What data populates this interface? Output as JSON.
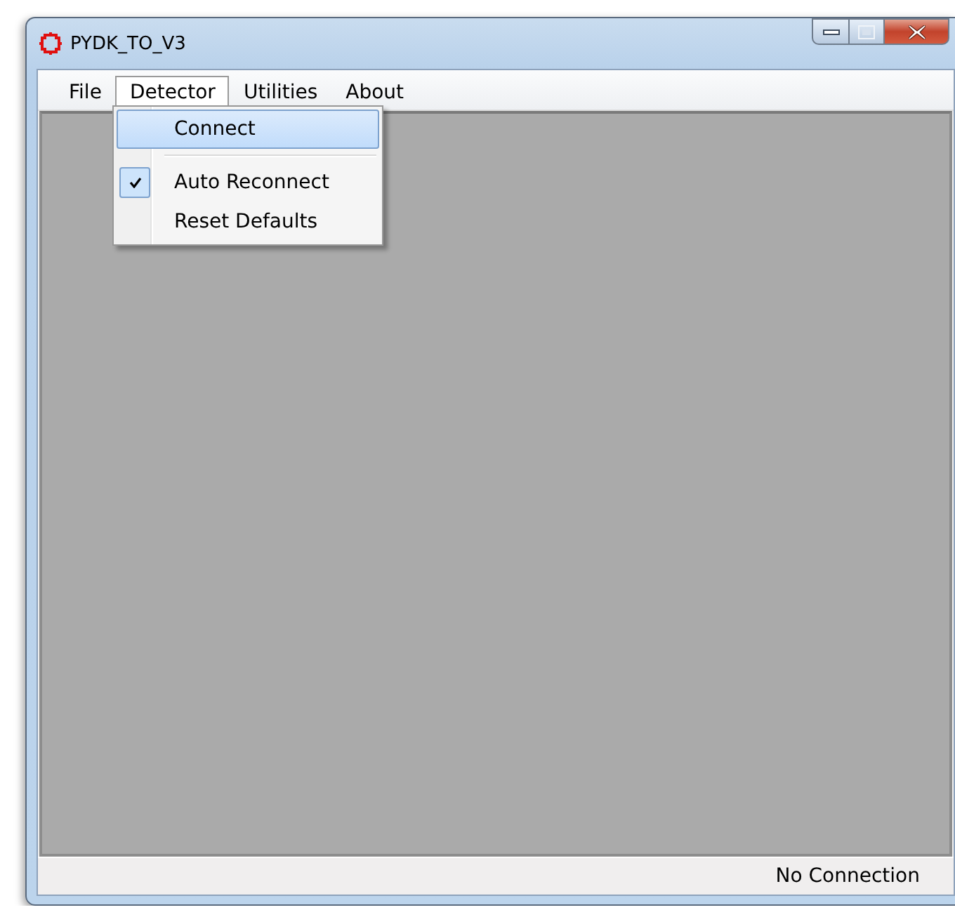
{
  "window": {
    "title": "PYDK_TO_V3"
  },
  "menu_bar": [
    {
      "label": "File",
      "selected": false
    },
    {
      "label": "Detector",
      "selected": true
    },
    {
      "label": "Utilities",
      "selected": false
    },
    {
      "label": "About",
      "selected": false
    }
  ],
  "dropdown": [
    {
      "kind": "item",
      "label": "Connect",
      "selected": true,
      "checked": false
    },
    {
      "kind": "separator"
    },
    {
      "kind": "item",
      "label": "Auto Reconnect",
      "selected": false,
      "checked": true
    },
    {
      "kind": "item",
      "label": "Reset Defaults",
      "selected": false,
      "checked": false
    }
  ],
  "status_bar": {
    "text": "No Connection"
  }
}
